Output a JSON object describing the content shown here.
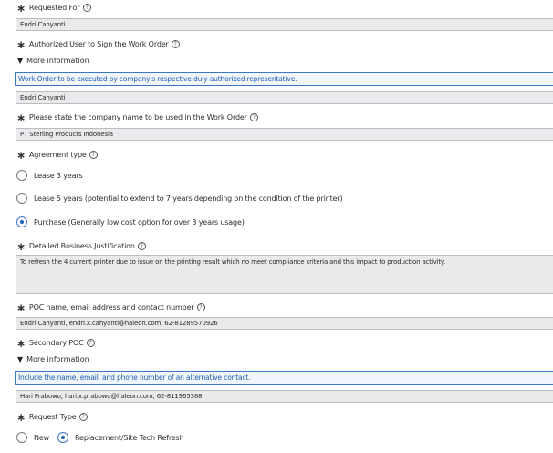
{
  "requested_for": {
    "label": "Requested For",
    "value": "Endri Cahyanti"
  },
  "authorized_user": {
    "label": "Authorized User to Sign the Work Order",
    "more_info_label": "More information",
    "info_text": "Work Order to be executed by company's respective duly authorized representative.",
    "value": "Endri Cahyanti"
  },
  "company_name": {
    "label": "Please state the company name to be used in the Work Order",
    "value": "PT Sterling Products Indonesia"
  },
  "agreement_type": {
    "label": "Agreement type",
    "options": [
      {
        "label": "Lease 3 years",
        "selected": false
      },
      {
        "label": "Lease 5 years (potential to extend to 7 years depending on the condition of the printer)",
        "selected": false
      },
      {
        "label": "Purchase (Generally low cost option for over 3 years usage)",
        "selected": true
      }
    ]
  },
  "business_justification": {
    "label": "Detailed Business Justification",
    "value": "To refresh the 4 current printer due to issue on the printing result which no meet compliance criteria and this impact to production activity."
  },
  "poc": {
    "label": "POC name, email address and contact number",
    "value": "Endri Cahyanti, endri.x.cahyanti@haleon.com, 62-81289570926"
  },
  "secondary_poc": {
    "label": "Secondary POC",
    "more_info_label": "More information",
    "info_text": "Include the name, email, and phone number of an alternative contact.",
    "value": "Hari Prabowo, hari.x.prabowo@haleon.com, 62-811965368"
  },
  "request_type": {
    "label": "Request Type",
    "options": [
      {
        "label": "New",
        "selected": false
      },
      {
        "label": "Replacement/Site Tech Refresh",
        "selected": true
      }
    ]
  },
  "icons": {
    "required": "asterisk-icon",
    "help": "help-circle-icon",
    "expand": "triangle-down-icon"
  },
  "colors": {
    "accent": "#1f5fae",
    "field_bg": "#e9eaec",
    "info_bg": "#f1f6fc"
  }
}
